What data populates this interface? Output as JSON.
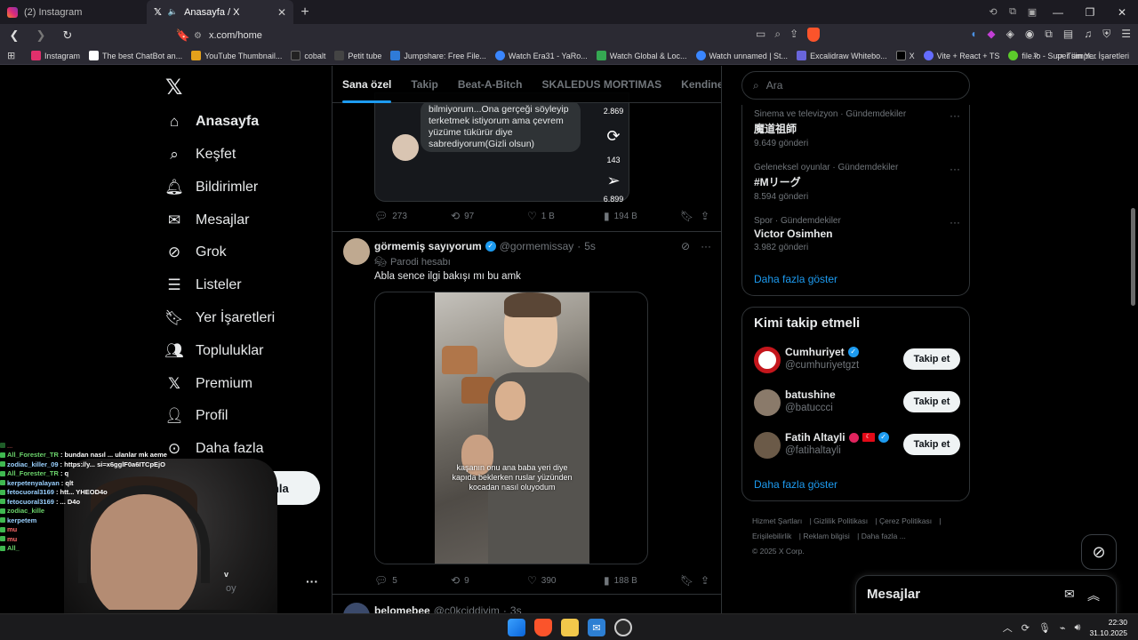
{
  "browser": {
    "tabs": [
      {
        "title": "(2) Instagram",
        "active": false,
        "icon": "instagram-icon"
      },
      {
        "title": "Anasayfa / X",
        "active": true,
        "icon": "x-icon"
      }
    ],
    "url": "x.com/home",
    "bookmarks": [
      {
        "label": "Instagram",
        "color": "#e1306c"
      },
      {
        "label": "The best ChatBot an...",
        "color": "#ffffff"
      },
      {
        "label": "YouTube Thumbnail...",
        "color": "#e4a11b"
      },
      {
        "label": "cobalt",
        "color": "#222222"
      },
      {
        "label": "Petit tube",
        "color": "#444444"
      },
      {
        "label": "Jumpshare: Free File...",
        "color": "#2f7bd8"
      },
      {
        "label": "Watch Era31 - YaRo...",
        "color": "#3a86ff"
      },
      {
        "label": "Watch Global & Loc...",
        "color": "#35a852"
      },
      {
        "label": "Watch unnamed | St...",
        "color": "#3a86ff"
      },
      {
        "label": "Excalidraw Whitebo...",
        "color": "#6965db"
      },
      {
        "label": "X",
        "color": "#000000"
      },
      {
        "label": "Vite + React + TS",
        "color": "#646cff"
      },
      {
        "label": "file.io - Super simpl...",
        "color": "#5ccb2b"
      }
    ],
    "all_bookmarks": "Tüm Yer İşaretleri"
  },
  "nav": {
    "items": [
      {
        "label": "Anasayfa",
        "icon": "home-icon"
      },
      {
        "label": "Keşfet",
        "icon": "search-icon"
      },
      {
        "label": "Bildirimler",
        "icon": "bell-icon"
      },
      {
        "label": "Mesajlar",
        "icon": "mail-icon"
      },
      {
        "label": "Grok",
        "icon": "grok-icon"
      },
      {
        "label": "Listeler",
        "icon": "list-icon"
      },
      {
        "label": "Yer İşaretleri",
        "icon": "bookmark-icon"
      },
      {
        "label": "Topluluklar",
        "icon": "communities-icon"
      },
      {
        "label": "Premium",
        "icon": "x-icon"
      },
      {
        "label": "Profil",
        "icon": "profile-icon"
      },
      {
        "label": "Daha fazla",
        "icon": "more-circle-icon"
      }
    ],
    "post_button": "Gönderi yayınla"
  },
  "feed": {
    "tabs": [
      "Sana özel",
      "Takip",
      "Beat-A-Bitch",
      "SKALEDUS MORTIMAS",
      "Kendine Müz"
    ],
    "embed": {
      "bubble_text": "bilmiyorum...Ona gerçeği söyleyip terketmek istiyorum ama çevrem yüzüme tükürür diye sabrediyorum(Gizli olsun)",
      "stat_top": "2.869",
      "stat_mid": "143",
      "stat_bottom": "6.899"
    },
    "post1_actions": {
      "replies": "273",
      "reposts": "97",
      "likes": "1 B",
      "views": "194 B"
    },
    "post2": {
      "name": "görmemiş sayıyorum",
      "handle": "@gormemissay",
      "time": "5s",
      "parody": "Parodi hesabı",
      "text": "Abla sence ilgi bakışı mı bu amk",
      "caption": "kaşanın onu ana baba yeri diye kapıda beklerken ruslar yüzünden kocadan nasıl oluyodum",
      "actions": {
        "replies": "5",
        "reposts": "9",
        "likes": "390",
        "views": "188 B"
      }
    },
    "post3": {
      "name": "belomebee",
      "handle": "@c0kciddiyim",
      "time": "3s"
    }
  },
  "right": {
    "search_placeholder": "Ara",
    "trends": [
      {
        "category": "Sinema ve televizyon · Gündemdekiler",
        "title": "魔道祖師",
        "count": "9.649 gönderi"
      },
      {
        "category": "Geleneksel oyunlar · Gündemdekiler",
        "title": "#Mリーグ",
        "count": "8.594 gönderi"
      },
      {
        "category": "Spor · Gündemdekiler",
        "title": "Victor Osimhen",
        "count": "3.982 gönderi"
      }
    ],
    "show_more": "Daha fazla göster",
    "who_to_follow": {
      "title": "Kimi takip etmeli",
      "users": [
        {
          "name": "Cumhuriyet",
          "handle": "@cumhuriyetgzt",
          "button": "Takip et",
          "avatar_color": "#c4161c"
        },
        {
          "name": "batushine",
          "handle": "@batuccci",
          "button": "Takip et",
          "avatar_color": "#8a7a6a"
        },
        {
          "name": "Fatih Altayli",
          "handle": "@fatihaltayli",
          "button": "Takip et",
          "avatar_color": "#6b5a48"
        }
      ],
      "show_more": "Daha fazla göster"
    },
    "footer": [
      "Hizmet Şartları",
      "Gizlilik Politikası",
      "Çerez Politikası",
      "Erişilebilirlik",
      "Reklam bilgisi",
      "Daha fazla ...",
      "© 2025 X Corp."
    ]
  },
  "messages_drawer": {
    "title": "Mesajlar"
  },
  "stream": {
    "chat": [
      {
        "user": "All_Forester_TR",
        "text": ": bundan nasıl ... ulanlar mk aeme"
      },
      {
        "user": "zodiac_killer_09",
        "text": ": https://y... si=x6gglF0a6ITCpEjO"
      },
      {
        "user": "All_Forester_TR",
        "text": ": q"
      },
      {
        "user": "kerpetenyalayan",
        "text": ": qlt"
      },
      {
        "user": "fetocuoral3169",
        "text": ": htt... YHEOD4o"
      },
      {
        "user": "fetocuoral3169",
        "text": ": ... D4o"
      },
      {
        "user": "zodiac_kille",
        "text": ""
      },
      {
        "user": "kerpetem",
        "text": ""
      },
      {
        "user": "mu",
        "text": ""
      },
      {
        "user": "mu",
        "text": ""
      },
      {
        "user": "All_",
        "text": ""
      }
    ],
    "cam_text1": "v",
    "cam_text2": "oy"
  },
  "taskbar": {
    "time": "22:30",
    "date": "31.10.2025"
  }
}
